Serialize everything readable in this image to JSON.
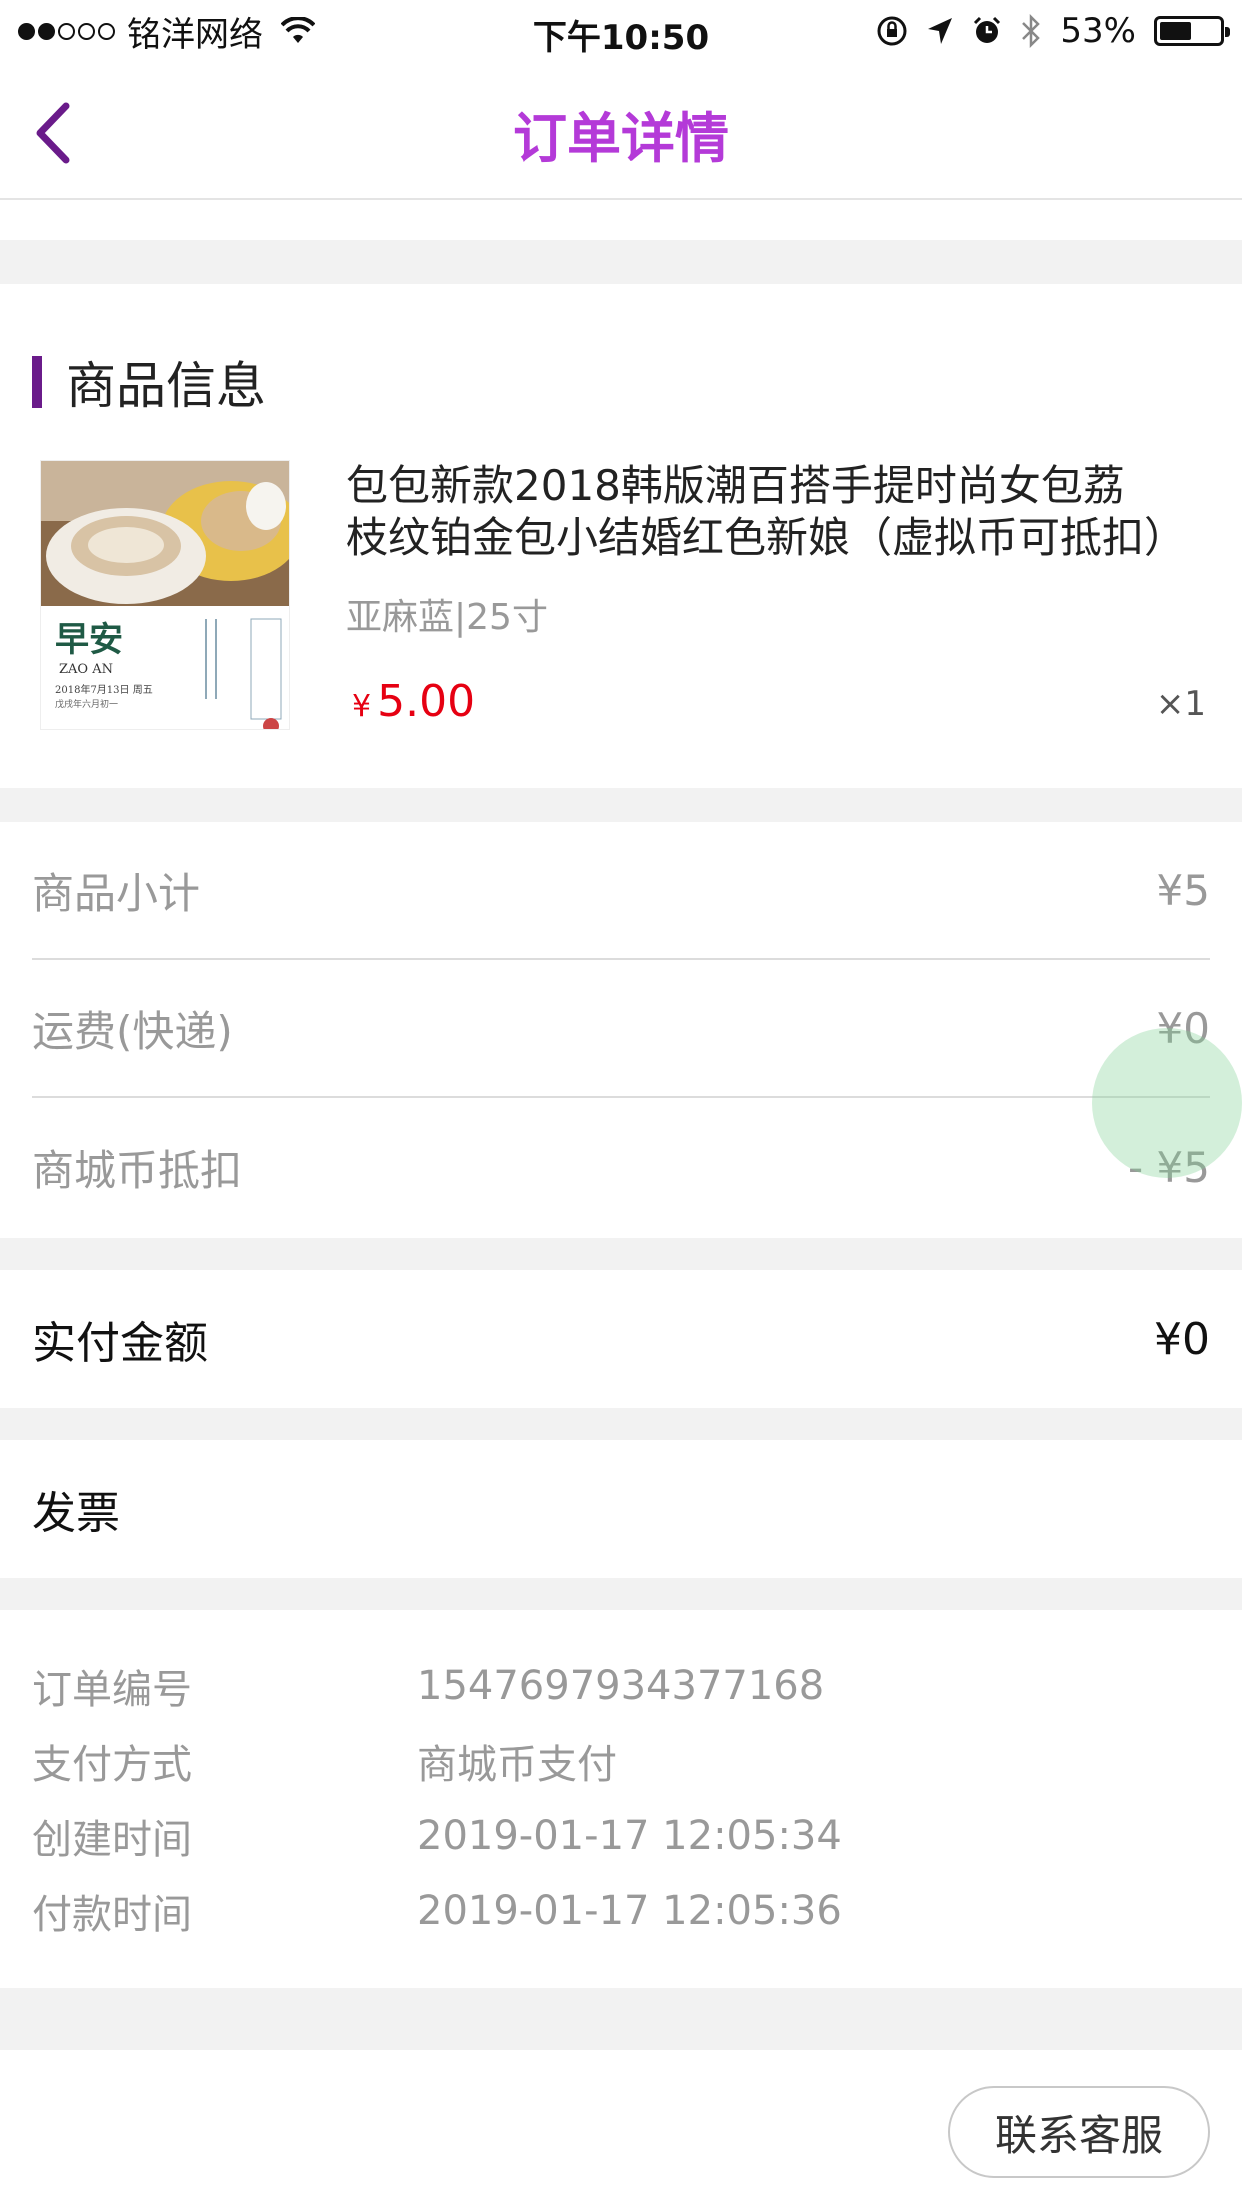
{
  "status_bar": {
    "carrier": "铭洋网络",
    "time": "下午10:50",
    "battery_percent": "53%",
    "battery_level": 0.53
  },
  "nav": {
    "title": "订单详情",
    "title_color": "#b43ad8"
  },
  "product_section": {
    "title": "商品信息",
    "accent_color": "#6a1b8a",
    "product": {
      "name_line1": "包包新款2018韩版潮百搭手提时尚女包荔",
      "name_line2": "枝纹铂金包小结婚红色新娘（虚拟币可抵扣）",
      "spec": "亚麻蓝|25寸",
      "price_symbol": "¥",
      "price": "5.00",
      "price_color": "#e60012",
      "quantity": "×1",
      "thumbnail": {
        "title": "早安",
        "subtitle": "ZAO AN",
        "date": "2018年7月13日 周五",
        "lunar": "戊戌年六月初一"
      }
    }
  },
  "cost_summary": {
    "rows": [
      {
        "label": "商品小计",
        "value": "¥5"
      },
      {
        "label": "运费(快递)",
        "value": "¥0"
      },
      {
        "label": "商城币抵扣",
        "value": "- ¥5"
      }
    ]
  },
  "payment": {
    "label": "实付金额",
    "value": "¥0"
  },
  "invoice": {
    "label": "发票"
  },
  "order_info": {
    "rows": [
      {
        "label": "订单编号",
        "value": "1547697934377168"
      },
      {
        "label": "支付方式",
        "value": "商城币支付"
      },
      {
        "label": "创建时间",
        "value": "2019-01-17 12:05:34"
      },
      {
        "label": "付款时间",
        "value": "2019-01-17 12:05:36"
      }
    ]
  },
  "footer": {
    "contact_label": "联系客服"
  }
}
